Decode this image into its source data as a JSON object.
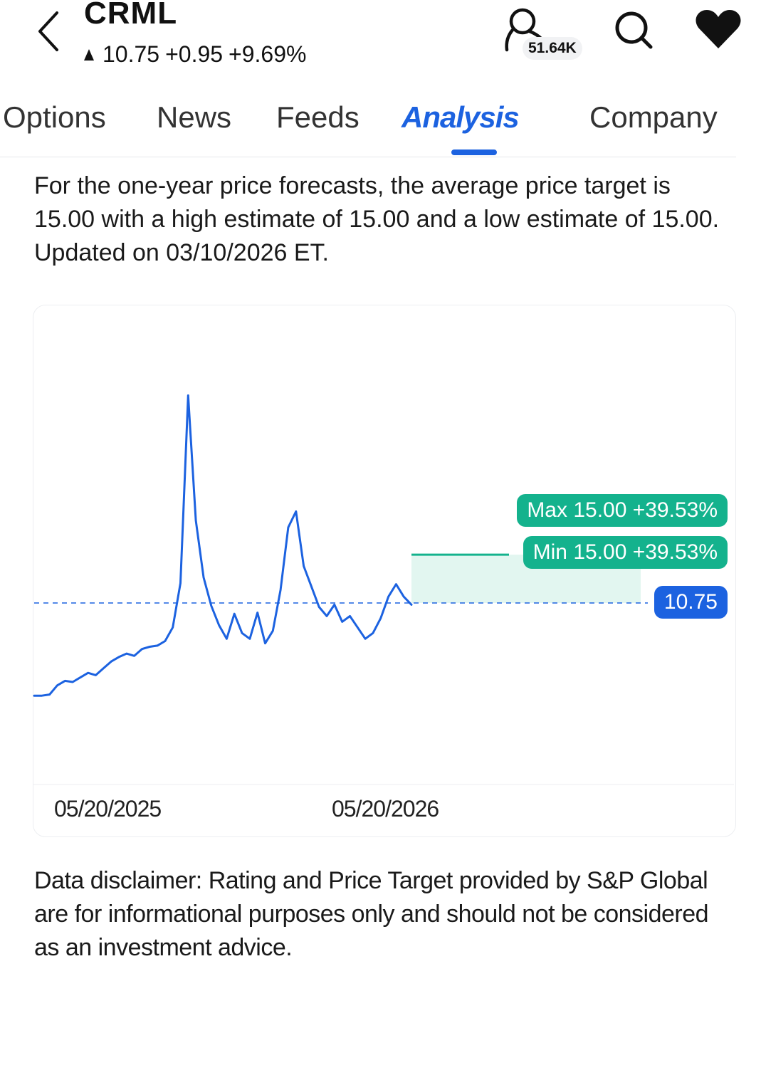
{
  "header": {
    "ticker": "CRML",
    "price": "10.75",
    "change": "+0.95",
    "change_pct": "+9.69%",
    "follower_count": "51.64K",
    "icons": [
      "back-icon",
      "follow-person-icon",
      "search-icon",
      "heart-icon"
    ]
  },
  "tabs": [
    {
      "label": "Options",
      "active": false
    },
    {
      "label": "News",
      "active": false
    },
    {
      "label": "Feeds",
      "active": false
    },
    {
      "label": "Analysis",
      "active": true
    },
    {
      "label": "Company",
      "active": false
    }
  ],
  "description": "For the one-year price forecasts, the average price target is 15.00 with a high estimate of 15.00 and a low estimate of 15.00. Updated on 03/10/2026 ET.",
  "chart": {
    "x_start_label": "05/20/2025",
    "x_end_label": "05/20/2026",
    "max_label": "Max 15.00 +39.53%",
    "min_label": "Min 15.00 +39.53%",
    "current_label": "10.75",
    "colors": {
      "line": "#1c62e0",
      "target": "#14b28d",
      "target_fill": "#e2f6f0",
      "current": "#1c62e0"
    }
  },
  "chart_data": {
    "type": "line",
    "x_range": [
      "05/20/2025",
      "05/20/2026"
    ],
    "current_price": 10.75,
    "target_high": 15.0,
    "target_low": 15.0,
    "target_high_pct": "+39.53%",
    "target_low_pct": "+39.53%",
    "price_series": [
      2.6,
      2.6,
      2.7,
      3.5,
      3.9,
      3.8,
      4.2,
      4.6,
      4.4,
      5.0,
      5.6,
      6.0,
      6.3,
      6.1,
      6.7,
      6.9,
      7.0,
      7.4,
      8.6,
      12.5,
      29.0,
      18.0,
      13.0,
      10.5,
      8.8,
      7.6,
      9.8,
      8.1,
      7.6,
      9.9,
      7.2,
      8.3,
      11.9,
      17.4,
      18.8,
      14.0,
      12.2,
      10.4,
      9.6,
      10.6,
      9.1,
      9.6,
      8.6,
      7.6,
      8.1,
      9.4,
      11.3,
      12.4,
      11.3,
      10.6
    ]
  },
  "disclaimer": "Data disclaimer: Rating and Price Target provided by S&P Global are for informational purposes only and should not be considered as an investment advice."
}
